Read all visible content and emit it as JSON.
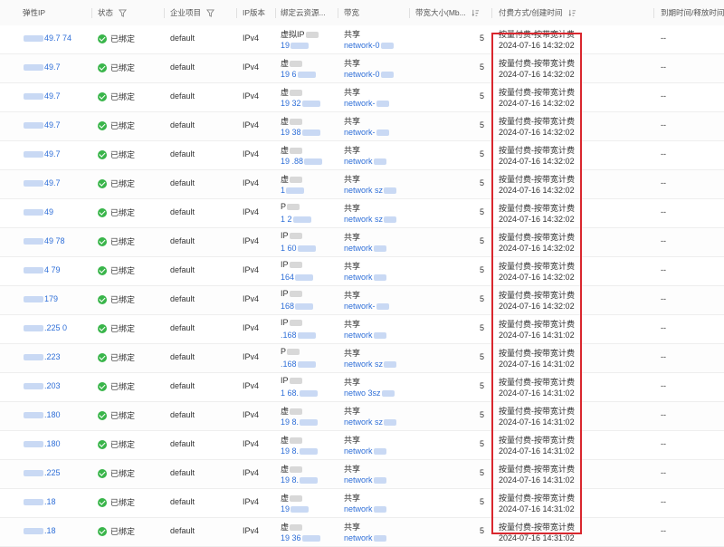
{
  "table": {
    "columns": {
      "eip": "弹性IP",
      "status": "状态",
      "project": "企业项目",
      "ip_version": "IP版本",
      "bound_resource": "绑定云资源...",
      "bandwidth": "带宽",
      "bandwidth_size": "带宽大小(Mb...",
      "billing": "付费方式/创建时间",
      "expire": "到期时间/释放时间"
    },
    "rows": [
      {
        "eip": "49.7  74",
        "status": "已绑定",
        "project": "default",
        "ip_version": "IPv4",
        "resource_type": "虚拟IP",
        "resource_id": "19",
        "bandwidth_type": "共享",
        "bandwidth_name": "network-0",
        "bandwidth_size": "5",
        "billing_mode": "按量付费-按带宽计费",
        "created": "2024-07-16 14:32:02",
        "expire": "--"
      },
      {
        "eip": "49.7",
        "status": "已绑定",
        "project": "default",
        "ip_version": "IPv4",
        "resource_type": "虚",
        "resource_id": "19  6",
        "bandwidth_type": "共享",
        "bandwidth_name": "network-0",
        "bandwidth_size": "5",
        "billing_mode": "按量付费-按带宽计费",
        "created": "2024-07-16 14:32:02",
        "expire": "--"
      },
      {
        "eip": "49.7",
        "status": "已绑定",
        "project": "default",
        "ip_version": "IPv4",
        "resource_type": "虚",
        "resource_id": "19  32",
        "bandwidth_type": "共享",
        "bandwidth_name": "network-",
        "bandwidth_size": "5",
        "billing_mode": "按量付费-按带宽计费",
        "created": "2024-07-16 14:32:02",
        "expire": "--"
      },
      {
        "eip": "49.7",
        "status": "已绑定",
        "project": "default",
        "ip_version": "IPv4",
        "resource_type": "虚",
        "resource_id": "19  38",
        "bandwidth_type": "共享",
        "bandwidth_name": "network-",
        "bandwidth_size": "5",
        "billing_mode": "按量付费-按带宽计费",
        "created": "2024-07-16 14:32:02",
        "expire": "--"
      },
      {
        "eip": "49.7",
        "status": "已绑定",
        "project": "default",
        "ip_version": "IPv4",
        "resource_type": "虚",
        "resource_id": "19  .88",
        "bandwidth_type": "共享",
        "bandwidth_name": "network",
        "bandwidth_size": "5",
        "billing_mode": "按量付费-按带宽计费",
        "created": "2024-07-16 14:32:02",
        "expire": "--"
      },
      {
        "eip": "49.7",
        "status": "已绑定",
        "project": "default",
        "ip_version": "IPv4",
        "resource_type": "虚",
        "resource_id": "1",
        "bandwidth_type": "共享",
        "bandwidth_name": "network  sz",
        "bandwidth_size": "5",
        "billing_mode": "按量付费-按带宽计费",
        "created": "2024-07-16 14:32:02",
        "expire": "--"
      },
      {
        "eip": "49",
        "status": "已绑定",
        "project": "default",
        "ip_version": "IPv4",
        "resource_type": "P",
        "resource_id": "1  2",
        "bandwidth_type": "共享",
        "bandwidth_name": "network  sz",
        "bandwidth_size": "5",
        "billing_mode": "按量付费-按带宽计费",
        "created": "2024-07-16 14:32:02",
        "expire": "--"
      },
      {
        "eip": "49  78",
        "status": "已绑定",
        "project": "default",
        "ip_version": "IPv4",
        "resource_type": "IP",
        "resource_id": "1  60",
        "bandwidth_type": "共享",
        "bandwidth_name": "network",
        "bandwidth_size": "5",
        "billing_mode": "按量付费-按带宽计费",
        "created": "2024-07-16 14:32:02",
        "expire": "--"
      },
      {
        "eip": "4  79",
        "status": "已绑定",
        "project": "default",
        "ip_version": "IPv4",
        "resource_type": "IP",
        "resource_id": "164",
        "bandwidth_type": "共享",
        "bandwidth_name": "network",
        "bandwidth_size": "5",
        "billing_mode": "按量付费-按带宽计费",
        "created": "2024-07-16 14:32:02",
        "expire": "--"
      },
      {
        "eip": "179",
        "status": "已绑定",
        "project": "default",
        "ip_version": "IPv4",
        "resource_type": "IP",
        "resource_id": "168",
        "bandwidth_type": "共享",
        "bandwidth_name": "network-",
        "bandwidth_size": "5",
        "billing_mode": "按量付费-按带宽计费",
        "created": "2024-07-16 14:32:02",
        "expire": "--"
      },
      {
        "eip": ".225  0",
        "status": "已绑定",
        "project": "default",
        "ip_version": "IPv4",
        "resource_type": "IP",
        "resource_id": ".168",
        "bandwidth_type": "共享",
        "bandwidth_name": "network",
        "bandwidth_size": "5",
        "billing_mode": "按量付费-按带宽计费",
        "created": "2024-07-16 14:31:02",
        "expire": "--"
      },
      {
        "eip": ".223",
        "status": "已绑定",
        "project": "default",
        "ip_version": "IPv4",
        "resource_type": "P",
        "resource_id": ".168",
        "bandwidth_type": "共享",
        "bandwidth_name": "network  sz",
        "bandwidth_size": "5",
        "billing_mode": "按量付费-按带宽计费",
        "created": "2024-07-16 14:31:02",
        "expire": "--"
      },
      {
        "eip": ".203",
        "status": "已绑定",
        "project": "default",
        "ip_version": "IPv4",
        "resource_type": "IP",
        "resource_id": "1  68.",
        "bandwidth_type": "共享",
        "bandwidth_name": "netwo  3sz",
        "bandwidth_size": "5",
        "billing_mode": "按量付费-按带宽计费",
        "created": "2024-07-16 14:31:02",
        "expire": "--"
      },
      {
        "eip": ".180",
        "status": "已绑定",
        "project": "default",
        "ip_version": "IPv4",
        "resource_type": "虚",
        "resource_id": "19  8.",
        "bandwidth_type": "共享",
        "bandwidth_name": "network  sz",
        "bandwidth_size": "5",
        "billing_mode": "按量付费-按带宽计费",
        "created": "2024-07-16 14:31:02",
        "expire": "--"
      },
      {
        "eip": ".180",
        "status": "已绑定",
        "project": "default",
        "ip_version": "IPv4",
        "resource_type": "虚",
        "resource_id": "19  8.",
        "bandwidth_type": "共享",
        "bandwidth_name": "network",
        "bandwidth_size": "5",
        "billing_mode": "按量付费-按带宽计费",
        "created": "2024-07-16 14:31:02",
        "expire": "--"
      },
      {
        "eip": ".225",
        "status": "已绑定",
        "project": "default",
        "ip_version": "IPv4",
        "resource_type": "虚",
        "resource_id": "19  8.",
        "bandwidth_type": "共享",
        "bandwidth_name": "network",
        "bandwidth_size": "5",
        "billing_mode": "按量付费-按带宽计费",
        "created": "2024-07-16 14:31:02",
        "expire": "--"
      },
      {
        "eip": ".18",
        "status": "已绑定",
        "project": "default",
        "ip_version": "IPv4",
        "resource_type": "虚",
        "resource_id": "19",
        "bandwidth_type": "共享",
        "bandwidth_name": "network",
        "bandwidth_size": "5",
        "billing_mode": "按量付费-按带宽计费",
        "created": "2024-07-16 14:31:02",
        "expire": "--"
      },
      {
        "eip": ".18",
        "status": "已绑定",
        "project": "default",
        "ip_version": "IPv4",
        "resource_type": "虚",
        "resource_id": "19  36",
        "bandwidth_type": "共享",
        "bandwidth_name": "network",
        "bandwidth_size": "5",
        "billing_mode": "按量付费-按带宽计费",
        "created": "2024-07-16 14:31:02",
        "expire": "--"
      }
    ]
  },
  "colors": {
    "link": "#2f6fd8",
    "status_ok": "#39b54a",
    "highlight": "#d9272e"
  },
  "icons": {
    "filter": "filter-icon",
    "sort": "sort-icon",
    "status": "check-circle-icon"
  }
}
